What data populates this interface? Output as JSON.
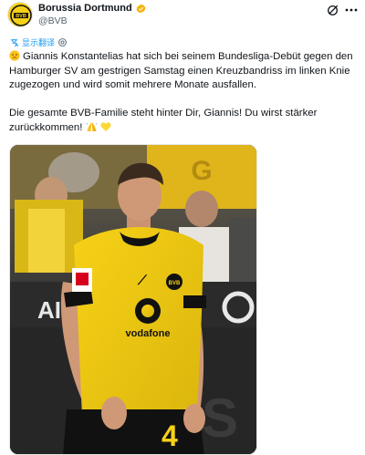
{
  "account": {
    "name": "Borussia Dortmund",
    "handle": "@BVB",
    "avatar_logo_text": "BVB",
    "verified_color": "#f6b20a"
  },
  "translate": {
    "label": "显示翻译"
  },
  "tweet": {
    "line1_emoji": "sad-face-emoji",
    "paragraph1": "Giannis Konstantelias hat sich bei seinem Bundesliga-Debüt gegen den Hamburger SV am gestrigen Samstag einen Kreuzbandriss im linken Knie zugezogen und wird somit mehrere Monate ausfallen.",
    "paragraph2": "Die gesamte BVB-Familie steht hinter Dir, Giannis! Du wirst stärker zurückkommen!",
    "paragraph2_emojis": [
      "folded-hands-emoji",
      "yellow-heart-emoji"
    ]
  },
  "media": {
    "sponsor_text": "vodafone",
    "shirt_number": "4",
    "crest_text": "BVB",
    "stadium_letters": "AI",
    "colors": {
      "shirt": "#f7d117",
      "trim": "#111111",
      "background": "#3a3a3a"
    }
  }
}
